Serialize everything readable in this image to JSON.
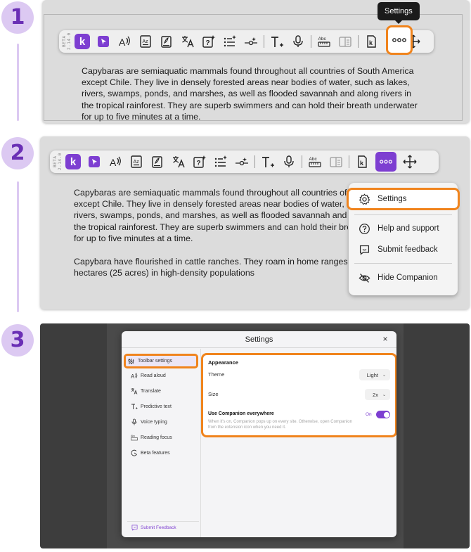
{
  "steps": [
    "1",
    "2",
    "3"
  ],
  "toolbar": {
    "beta_label": "BETA 2.14.0",
    "logo_letter": "k",
    "tooltip": "Settings"
  },
  "panel1": {
    "paragraph": "Capybaras are semiaquatic mammals found throughout all countries of South America except Chile. They live in densely forested areas near bodies of water, such as lakes, rivers, swamps, ponds, and marshes, as well as flooded savannah and along rivers in the tropical rainforest. They are superb swimmers and can hold their breath underwater for up to five minutes at a time."
  },
  "panel2": {
    "paragraph1": "Capybaras are semiaquatic mammals found throughout all countries of South America except Chile. They live in densely forested areas near bodies of water, such as lakes, rivers, swamps, ponds, and marshes, as well as flooded savannah and along rivers in the tropical rainforest. They are superb swimmers and can hold their breath underwater for up to five minutes at a time.",
    "paragraph2": "Capybara have flourished in cattle ranches. They roam in home ranges averaging 10 hectares (25 acres) in high-density populations",
    "menu": {
      "settings": "Settings",
      "help": "Help and support",
      "feedback": "Submit feedback",
      "hide": "Hide Companion"
    }
  },
  "panel3": {
    "title": "Settings",
    "close": "×",
    "sidebar": [
      {
        "label": "Toolbar settings",
        "icon": "sliders-icon"
      },
      {
        "label": "Read aloud",
        "icon": "read-aloud-icon"
      },
      {
        "label": "Translate",
        "icon": "translate-icon"
      },
      {
        "label": "Predictive text",
        "icon": "predictive-text-icon"
      },
      {
        "label": "Voice typing",
        "icon": "microphone-icon"
      },
      {
        "label": "Reading focus",
        "icon": "reading-focus-icon"
      },
      {
        "label": "Beta features",
        "icon": "beta-icon"
      }
    ],
    "submit_feedback": "Submit Feedback",
    "appearance": {
      "heading": "Appearance",
      "theme_label": "Theme",
      "theme_value": "Light",
      "size_label": "Size",
      "size_value": "2x",
      "everywhere_label": "Use Companion everywhere",
      "everywhere_hint": "When it's on, Companion pops up on every site. Otherwise, open Companion from the extension icon when you need it.",
      "toggle_label": "On"
    }
  },
  "colors": {
    "accent": "#7d3ed1",
    "highlight": "#f0841d",
    "step_circle": "#dcc9f2"
  }
}
